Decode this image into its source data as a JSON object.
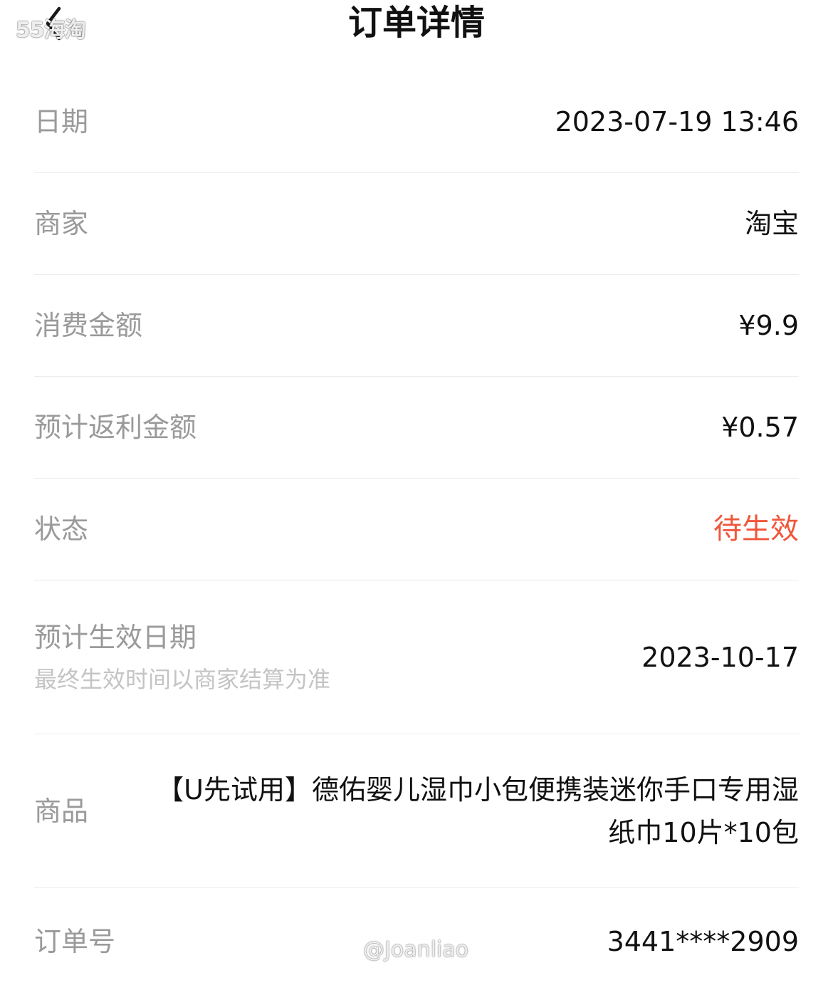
{
  "header": {
    "title": "订单详情",
    "back_icon": "chevron-left-icon",
    "brand_watermark": "55海淘"
  },
  "rows": {
    "date": {
      "label": "日期",
      "value": "2023-07-19 13:46"
    },
    "merchant": {
      "label": "商家",
      "value": "淘宝"
    },
    "amount": {
      "label": "消费金额",
      "value": "¥9.9"
    },
    "rebate": {
      "label": "预计返利金额",
      "value": "¥0.57"
    },
    "status": {
      "label": "状态",
      "value": "待生效",
      "color": "#f0563a"
    },
    "effective_date": {
      "label": "预计生效日期",
      "note": "最终生效时间以商家结算为准",
      "value": "2023-10-17"
    },
    "goods": {
      "label": "商品",
      "value": "【U先试用】德佑婴儿湿巾小包便携装迷你手口专用湿纸巾10片*10包"
    },
    "order_no": {
      "label": "订单号",
      "value": "3441****2909"
    }
  },
  "credit_watermark": "@Joanliao"
}
